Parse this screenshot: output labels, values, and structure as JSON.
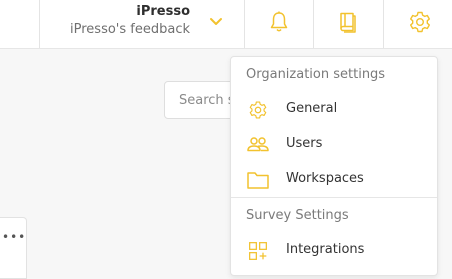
{
  "header": {
    "org_name": "iPresso",
    "org_subtitle": "iPresso's feedback",
    "icons": [
      "chevron-down-icon",
      "bell-icon",
      "book-icon",
      "gear-icon"
    ]
  },
  "search": {
    "placeholder": "Search s"
  },
  "menu": {
    "organization_header": "Organization settings",
    "organization_items": [
      {
        "label": "General",
        "icon": "gear-icon"
      },
      {
        "label": "Users",
        "icon": "users-icon"
      },
      {
        "label": "Workspaces",
        "icon": "folder-icon"
      }
    ],
    "survey_header": "Survey Settings",
    "survey_items": [
      {
        "label": "Integrations",
        "icon": "integrations-icon"
      }
    ]
  },
  "colors": {
    "accent": "#f2c22e"
  }
}
